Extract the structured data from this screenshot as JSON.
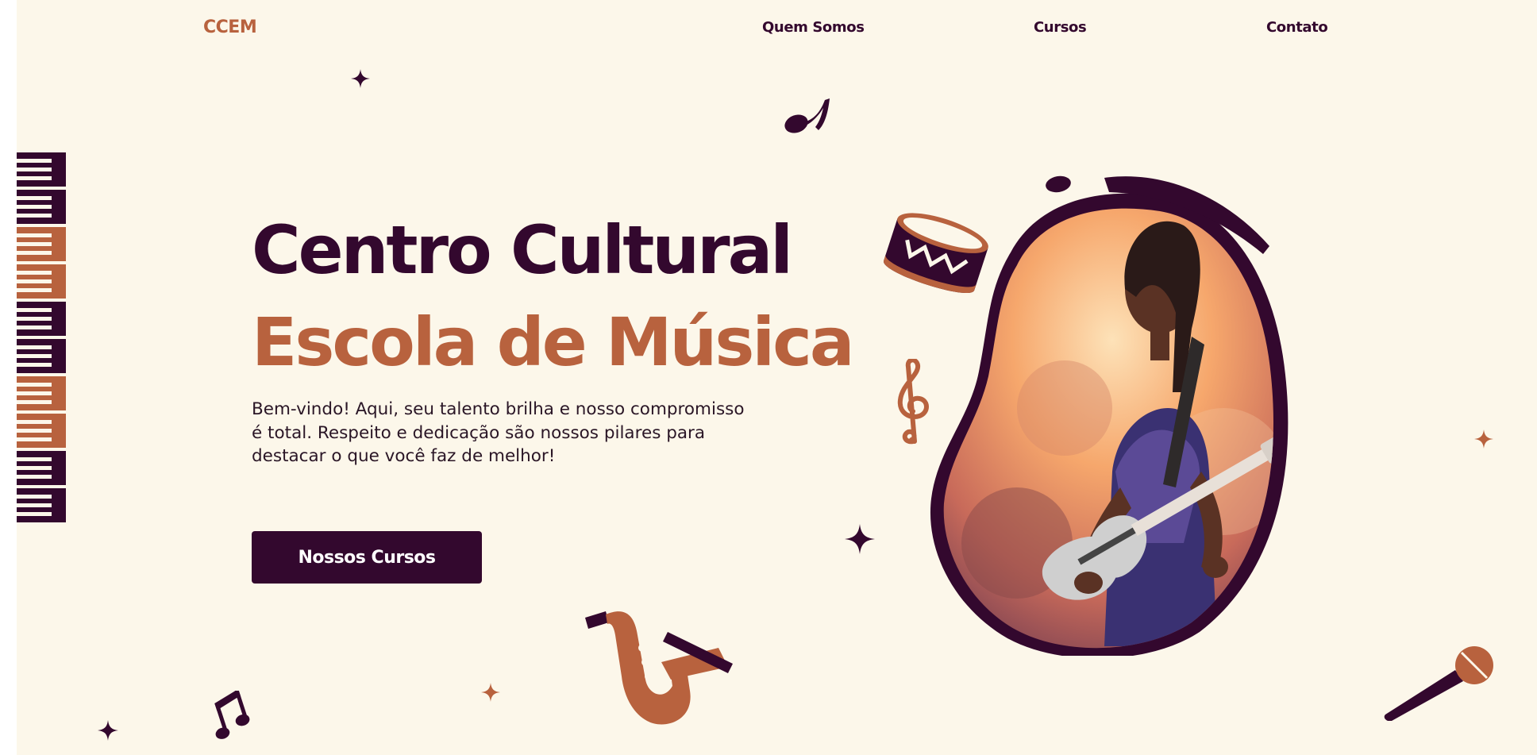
{
  "nav": {
    "logo": "CCEM",
    "links": [
      "Quem Somos",
      "Cursos",
      "Contato"
    ]
  },
  "hero": {
    "title_line1": "Centro Cultural",
    "title_line2": "Escola de Música",
    "description": "Bem-vindo! Aqui, seu talento brilha e nosso compromisso é total. Respeito e dedicação são nossos pilares para destacar o que você faz de melhor!",
    "cta_label": "Nossos Cursos"
  },
  "colors": {
    "background": "#fcf7ea",
    "plum": "#33082e",
    "terracotta": "#b8623e"
  },
  "decorations": [
    "piano-keys-icon",
    "drum-icon",
    "treble-clef-icon",
    "saxophone-icon",
    "microphone-icon",
    "music-note-icon",
    "double-note-icon",
    "sparkle-icon"
  ]
}
